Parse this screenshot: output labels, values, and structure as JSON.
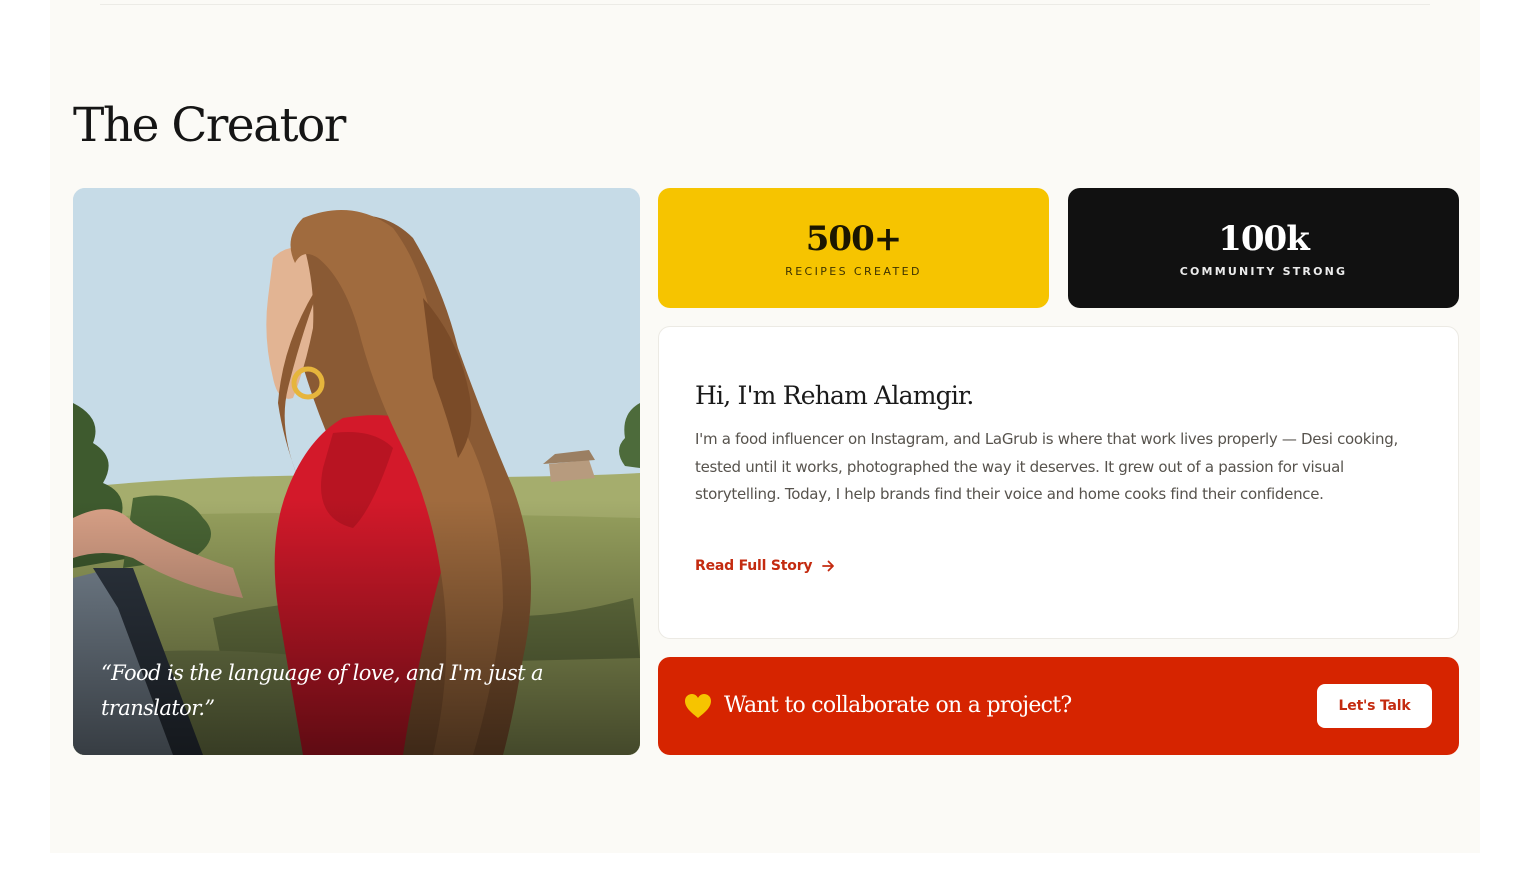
{
  "section": {
    "title": "The Creator"
  },
  "image_card": {
    "quote": "“Food is the language of love, and I'm just a translator.”"
  },
  "stats": [
    {
      "value": "500+",
      "label": "RECIPES CREATED"
    },
    {
      "value": "100k",
      "label": "COMMUNITY STRONG"
    }
  ],
  "bio": {
    "heading": "Hi, I'm Reham Alamgir.",
    "text": "I'm a food influencer on Instagram, and LaGrub is where that work lives properly — Desi cooking, tested until it works, photographed the way it deserves. It grew out of a passion for visual storytelling. Today, I help brands find their voice and home cooks find their confidence.",
    "link_label": "Read Full Story"
  },
  "cta": {
    "text": "Want to collaborate on a project?",
    "button_label": "Let's Talk"
  },
  "colors": {
    "background": "#fbfaf6",
    "accent_yellow": "#f6c400",
    "dark": "#111111",
    "accent_red": "#d62400",
    "link_red": "#c42b10"
  },
  "icons": {
    "link": "arrow-right-icon",
    "cta": "heart-icon"
  }
}
